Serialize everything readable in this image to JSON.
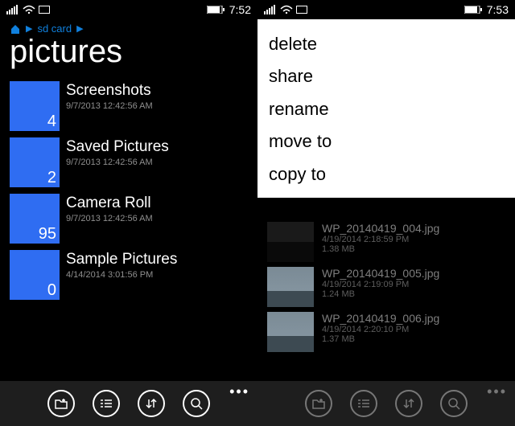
{
  "left": {
    "status": {
      "time": "7:52"
    },
    "breadcrumb": {
      "crumb1": "sd card"
    },
    "title": "pictures",
    "folders": [
      {
        "name": "Screenshots",
        "date": "9/7/2013 12:42:56 AM",
        "count": "4"
      },
      {
        "name": "Saved Pictures",
        "date": "9/7/2013 12:42:56 AM",
        "count": "2"
      },
      {
        "name": "Camera Roll",
        "date": "9/7/2013 12:42:56 AM",
        "count": "95"
      },
      {
        "name": "Sample Pictures",
        "date": "4/14/2014 3:01:56 PM",
        "count": "0"
      }
    ]
  },
  "right": {
    "status": {
      "time": "7:53"
    },
    "menu": {
      "delete": "delete",
      "share": "share",
      "rename": "rename",
      "moveto": "move to",
      "copyto": "copy to"
    },
    "files": [
      {
        "name": "WP_20140419_004.jpg",
        "date": "4/19/2014 2:18:59 PM",
        "size": "1.38 MB"
      },
      {
        "name": "WP_20140419_005.jpg",
        "date": "4/19/2014 2:19:09 PM",
        "size": "1.24 MB"
      },
      {
        "name": "WP_20140419_006.jpg",
        "date": "4/19/2014 2:20:10 PM",
        "size": "1.37 MB"
      }
    ]
  },
  "appbar_icons": {
    "newfolder": "new-folder-icon",
    "select": "select-icon",
    "sort": "sort-icon",
    "search": "search-icon"
  }
}
